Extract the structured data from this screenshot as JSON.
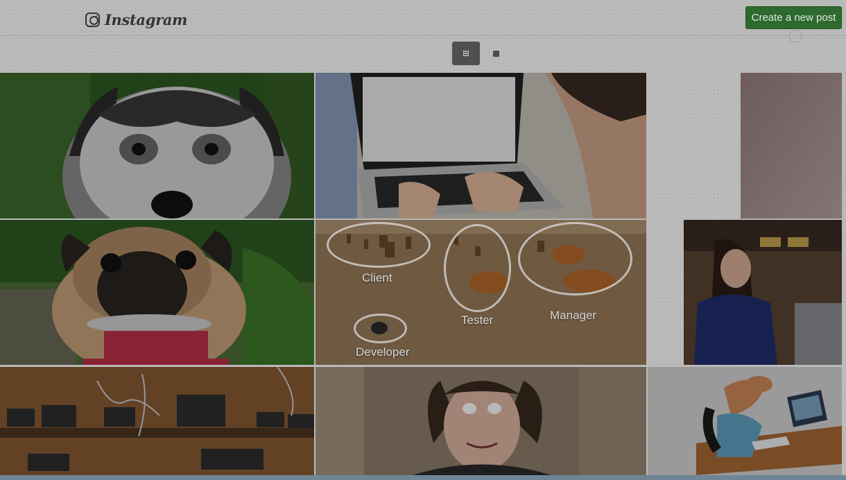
{
  "header": {
    "logo_text": "Instagram",
    "create_post_label": "Create a new post"
  },
  "view_toggle": {
    "grid_icon": "grid-icon",
    "single_icon": "square-icon"
  },
  "photos": [
    {
      "subject": "husky-puppy"
    },
    {
      "subject": "laptop-typing"
    },
    {
      "subject": "partial-pink"
    },
    {
      "subject": "pug-on-scale"
    },
    {
      "subject": "tigers-diagram"
    },
    {
      "subject": "woman-smiling"
    },
    {
      "subject": "phones-charging"
    },
    {
      "subject": "funny-face-girl"
    },
    {
      "subject": "cartoon-desk"
    }
  ],
  "tigers_diagram": {
    "labels": [
      "Client",
      "Tester",
      "Manager",
      "Developer"
    ]
  },
  "colors": {
    "button_green": "#2d6a2d",
    "toggle_dark": "#4f4f4f"
  }
}
